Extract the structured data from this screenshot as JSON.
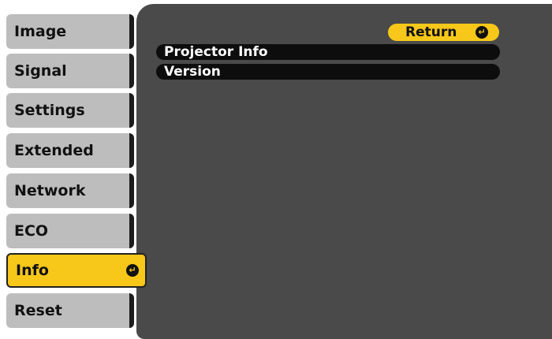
{
  "tabs": [
    {
      "label": "Image"
    },
    {
      "label": "Signal"
    },
    {
      "label": "Settings"
    },
    {
      "label": "Extended"
    },
    {
      "label": "Network"
    },
    {
      "label": "ECO"
    },
    {
      "label": "Info",
      "active": true
    },
    {
      "label": "Reset"
    }
  ],
  "return_button": {
    "label": "Return"
  },
  "menu_items": [
    {
      "label": "Projector Info"
    },
    {
      "label": "Version"
    }
  ],
  "icons": {
    "enter": "enter-icon"
  },
  "colors": {
    "active_tab": "#f7c71a",
    "tab": "#bdbdbd",
    "panel": "#4a4a4a",
    "row": "#0d0d0d"
  }
}
